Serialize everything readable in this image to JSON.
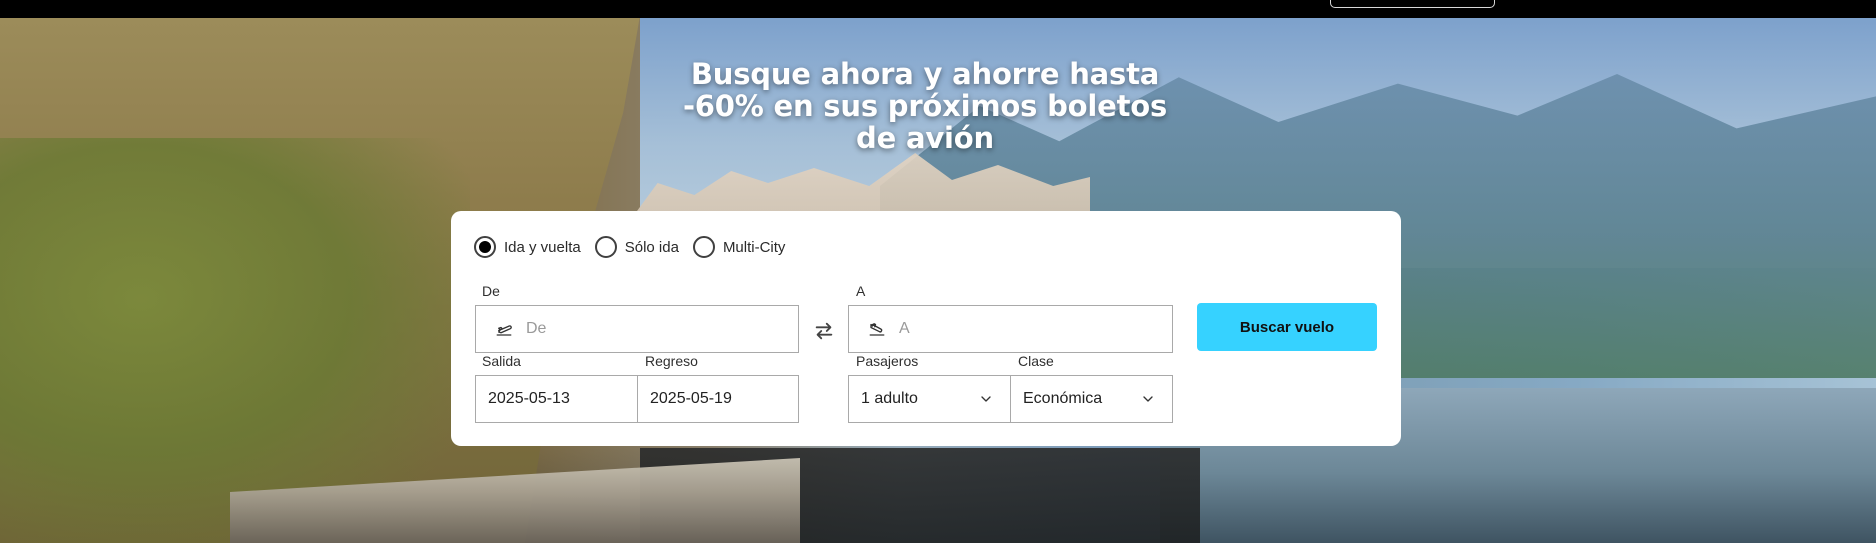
{
  "hero": {
    "headline": "Busque ahora y ahorre hasta -60% en sus próximos boletos de avión"
  },
  "search": {
    "trip_types": [
      {
        "label": "Ida y vuelta",
        "selected": true
      },
      {
        "label": "Sólo ida",
        "selected": false
      },
      {
        "label": "Multi-City",
        "selected": false
      }
    ],
    "from": {
      "label": "De",
      "placeholder": "De",
      "value": ""
    },
    "to": {
      "label": "A",
      "placeholder": "A",
      "value": ""
    },
    "departure": {
      "label": "Salida",
      "value": "2025-05-13"
    },
    "return": {
      "label": "Regreso",
      "value": "2025-05-19"
    },
    "passengers": {
      "label": "Pasajeros",
      "value": "1 adulto"
    },
    "cabin_class": {
      "label": "Clase",
      "value": "Económica"
    },
    "submit_label": "Buscar vuelo",
    "accent_color": "#36d2ff"
  },
  "icons": {
    "from": "plane-takeoff-icon",
    "to": "plane-landing-icon",
    "swap": "swap-arrows-icon",
    "chevron": "chevron-down-icon"
  }
}
